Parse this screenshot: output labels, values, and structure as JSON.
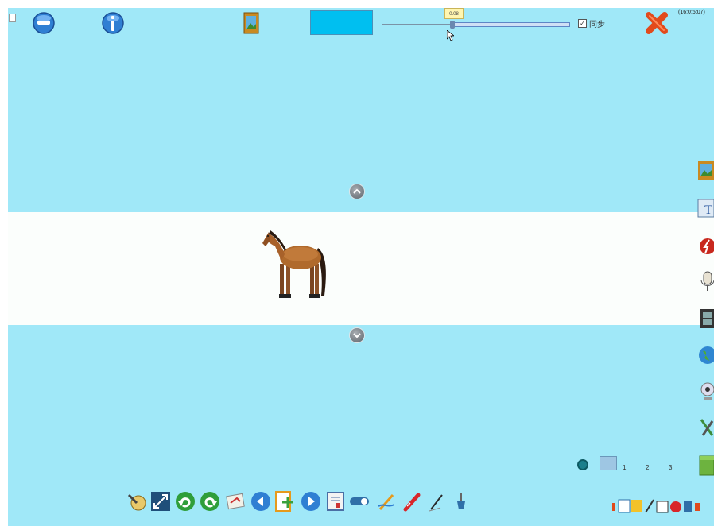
{
  "top": {
    "slider_tooltip": "0.08",
    "sync_label": "同步",
    "sync_checked": true,
    "time_text": "(16:0:5:07)"
  },
  "colors": {
    "stage_bg": "#a0e8f8",
    "band_bg": "#fbfefc",
    "swatch": "#00bff0"
  },
  "pager": {
    "items": [
      "1",
      "2",
      "3"
    ]
  },
  "icons": {
    "top_left": [
      "back-icon",
      "info-icon",
      "picture-icon",
      "close-icon"
    ],
    "bottom_toolbar": [
      "pen-icon",
      "move-icon",
      "undo-icon",
      "redo-icon",
      "eraser-icon",
      "prev-icon",
      "add-page-icon",
      "next-icon",
      "book-icon",
      "toggle-icon",
      "highlighter-icon",
      "marker-icon",
      "pencil-icon",
      "brush-icon"
    ],
    "right_toolbar": [
      "picture-icon",
      "text-icon",
      "flash-icon",
      "microphone-icon",
      "film-icon",
      "globe-icon",
      "webcam-icon",
      "tools-icon",
      "box-icon"
    ]
  }
}
